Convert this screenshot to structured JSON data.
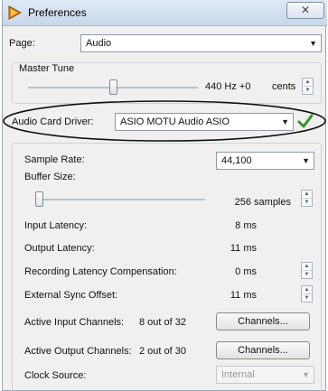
{
  "window": {
    "title": "Preferences",
    "close_glyph": "✕"
  },
  "page_selector": {
    "label": "Page:",
    "value": "Audio"
  },
  "master_tune": {
    "title": "Master Tune",
    "value_text": "440 Hz +0",
    "unit": "cents",
    "slider_position": 0.5
  },
  "driver": {
    "label": "Audio Card Driver:",
    "value": "ASIO MOTU Audio ASIO",
    "status_icon": "check-icon",
    "accent_color": "#2f9a1e"
  },
  "audio": {
    "sample_rate_label": "Sample Rate:",
    "sample_rate_value": "44,100",
    "buffer_size_label": "Buffer Size:",
    "buffer_size_value": "256 samples",
    "buffer_slider_position": 0.0,
    "input_latency_label": "Input Latency:",
    "input_latency_value": "8 ms",
    "output_latency_label": "Output Latency:",
    "output_latency_value": "11 ms",
    "rec_comp_label": "Recording Latency Compensation:",
    "rec_comp_value": "0 ms",
    "ext_sync_label": "External Sync Offset:",
    "ext_sync_value": "11 ms",
    "active_input_label": "Active Input Channels:",
    "active_input_value": "8 out of 32",
    "active_input_button": "Channels...",
    "active_output_label": "Active Output Channels:",
    "active_output_value": "2 out of 30",
    "active_output_button": "Channels...",
    "clock_source_label": "Clock Source:",
    "clock_source_value": "Internal"
  }
}
